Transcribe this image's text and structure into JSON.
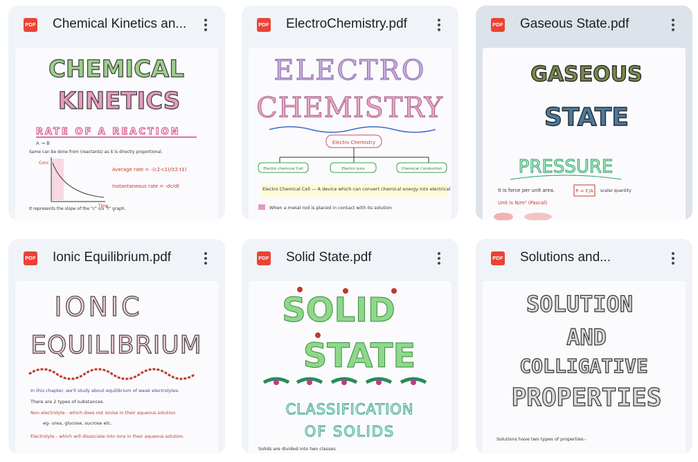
{
  "files": [
    {
      "name": "Chemical Kinetics and Rate of Reaction.pdf",
      "display_name": "Chemical Kinetics an...",
      "type_badge": "PDF",
      "preview": {
        "title_lines": [
          "CHEMICAL",
          "KINETICS"
        ],
        "subtitle": "RATE OF A REACTION",
        "notes": [
          "A → B",
          "Same can be done from (reactants) as it is directly proportional.",
          "Average rate = -(c2-c1)/(t2-t1)",
          "Instantaneous rate = -dc/dt",
          "It represents the slope of the \"c\" v/s \"t\" graph."
        ],
        "graph_x_label": "Time",
        "graph_y_label": "Conc"
      }
    },
    {
      "name": "ElectroChemistry.pdf",
      "display_name": "ElectroChemistry.pdf",
      "type_badge": "PDF",
      "preview": {
        "title_lines": [
          "ELECTRO",
          "CHEMISTRY"
        ],
        "center_box": "Electro Chemistry",
        "branches": [
          "Electro chemical Cell",
          "Electro-lysis",
          "Chemical Conduction"
        ],
        "notes": [
          "Electro Chemical Cell — A device which can convert chemical energy into electrical energy.",
          "When a metal rod is placed in contact with its solution"
        ]
      }
    },
    {
      "name": "Gaseous State.pdf",
      "display_name": "Gaseous State.pdf",
      "type_badge": "PDF",
      "selected": true,
      "preview": {
        "title_lines": [
          "GASEOUS",
          "STATE"
        ],
        "subtitle": "PRESSURE",
        "notes": [
          "It is force per unit area.",
          "P = F/A",
          "scalar quantity",
          "Unit is N/m² (Pascal)"
        ]
      }
    },
    {
      "name": "Ionic Equilibrium.pdf",
      "display_name": "Ionic Equilibrium.pdf",
      "type_badge": "PDF",
      "preview": {
        "title_lines": [
          "IONIC",
          "EQUILIBRIUM"
        ],
        "notes": [
          "In this chapter, we'll study about equilibrium of weak electrolytes.",
          "There are 2 types of substances.",
          "Non electrolyte - which does not ionise in their aqueous solution.",
          "eg- urea, glucose, sucrose etc.",
          "Electrolyte - which will dissociate into ions in their aqueous solution."
        ]
      }
    },
    {
      "name": "Solid State.pdf",
      "display_name": "Solid State.pdf",
      "type_badge": "PDF",
      "preview": {
        "title_lines": [
          "SOLID",
          "STATE"
        ],
        "subtitle_lines": [
          "CLASSIFICATION",
          "OF SOLIDS"
        ],
        "notes": [
          "Solids are divided into two classes"
        ]
      }
    },
    {
      "name": "Solutions and Colligative Properties.pdf",
      "display_name": "Solutions and...",
      "type_badge": "PDF",
      "preview": {
        "title_lines": [
          "SOLUTION",
          "AND",
          "COLLIGATIVE",
          "PROPERTIES"
        ],
        "notes": [
          "Solutions have two types of properties:-"
        ]
      }
    }
  ],
  "colors": {
    "card_bg": "#f0f4f9",
    "card_selected_bg": "#dde3ea",
    "pdf_badge": "#ea4335",
    "text": "#1f1f1f"
  },
  "icons": {
    "file_type": "pdf-icon",
    "menu": "more-vert-icon"
  }
}
